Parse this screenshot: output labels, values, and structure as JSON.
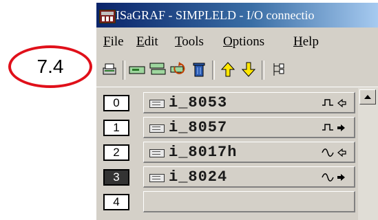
{
  "annotation": {
    "label": "7.4",
    "color": "#e0101a"
  },
  "window": {
    "title": "ISaGRAF - SIMPLELD - I/O connection",
    "title_visible": "ISaGRAF - SIMPLELD - I/O connectio"
  },
  "menu": [
    {
      "accel": "F",
      "rest": "ile"
    },
    {
      "accel": "E",
      "rest": "dit"
    },
    {
      "accel": "T",
      "rest": "ools"
    },
    {
      "accel": "O",
      "rest": "ptions"
    },
    {
      "accel": "H",
      "rest": "elp"
    }
  ],
  "toolbar": {
    "buttons": [
      "print-icon",
      "board-icon",
      "board-set-icon",
      "refresh-icon",
      "delete-icon",
      "move-up-icon",
      "move-down-icon",
      "tree-icon"
    ]
  },
  "slots": [
    {
      "num": "0",
      "board": "i_8053",
      "signal": "digital",
      "direction": "input"
    },
    {
      "num": "1",
      "board": "i_8057",
      "signal": "digital",
      "direction": "output"
    },
    {
      "num": "2",
      "board": "i_8017h",
      "signal": "analog",
      "direction": "input"
    },
    {
      "num": "3",
      "board": "i_8024",
      "signal": "analog",
      "direction": "output",
      "selected": true
    },
    {
      "num": "4",
      "board": ""
    }
  ]
}
